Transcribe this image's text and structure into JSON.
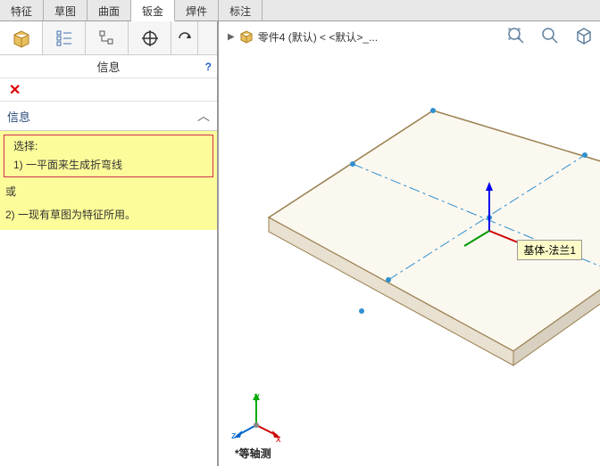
{
  "tabs": {
    "t0": "特征",
    "t1": "草图",
    "t2": "曲面",
    "t3": "钣金",
    "t4": "焊件",
    "t5": "标注"
  },
  "panel": {
    "title": "信息",
    "section": "信息",
    "select_label": "选择:",
    "option1": "1) 一平面来生成折弯线",
    "or": "或",
    "option2": "2) 一现有草图为特征所用。"
  },
  "breadcrumb": {
    "part": "零件4 (默认) < <默认>_..."
  },
  "tooltip": {
    "text": "基体-法兰1"
  },
  "axes": {
    "x": "x",
    "y": "y",
    "z": "z"
  },
  "view": {
    "label": "*等轴测"
  }
}
